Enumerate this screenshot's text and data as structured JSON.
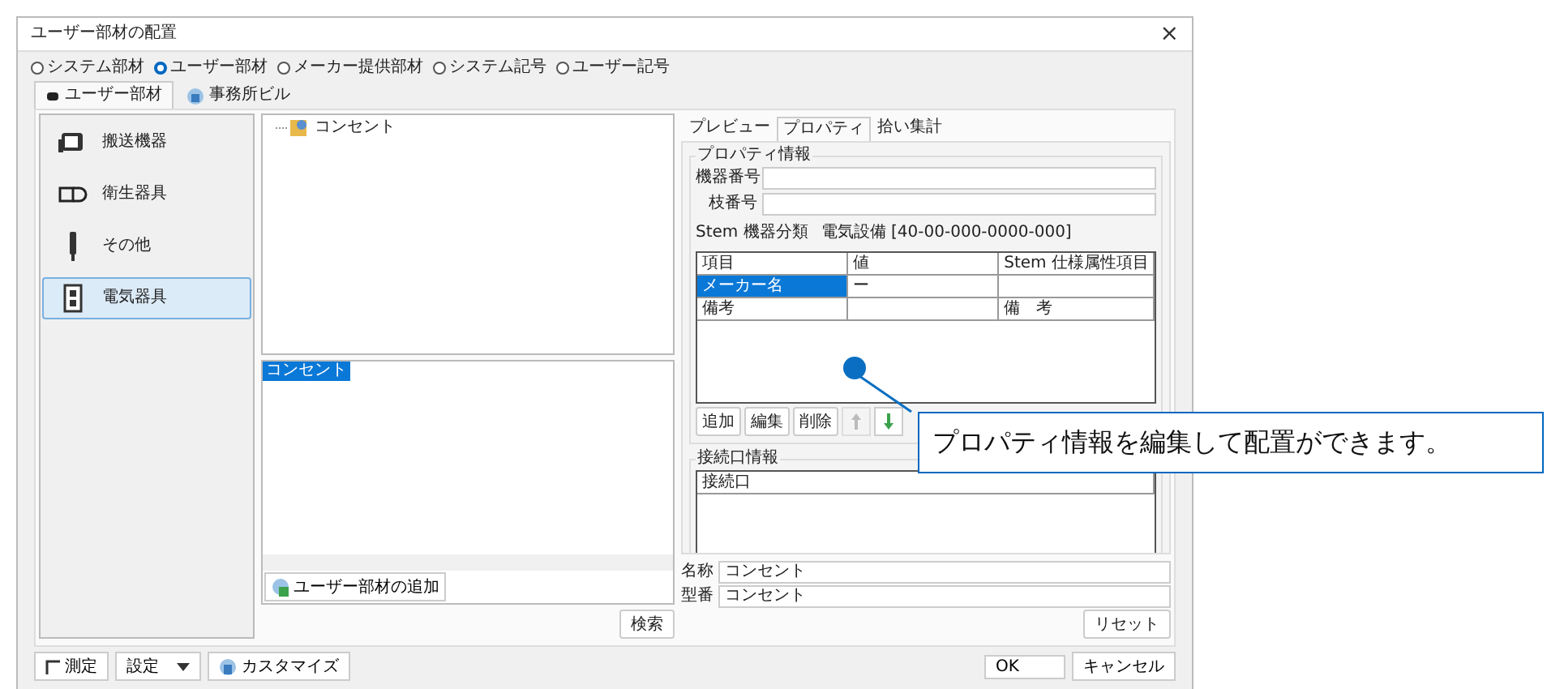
{
  "window": {
    "title": "ユーザー部材の配置",
    "close": "×"
  },
  "source_options": [
    {
      "label": "システム部材",
      "selected": false
    },
    {
      "label": "ユーザー部材",
      "selected": true
    },
    {
      "label": "メーカー提供部材",
      "selected": false
    },
    {
      "label": "システム記号",
      "selected": false
    },
    {
      "label": "ユーザー記号",
      "selected": false
    }
  ],
  "tabs": [
    {
      "label": "ユーザー部材",
      "selected": true
    },
    {
      "label": "事務所ビル",
      "selected": false
    }
  ],
  "categories": [
    {
      "label": "搬送機器",
      "kind": "conveyor",
      "selected": false
    },
    {
      "label": "衛生器具",
      "kind": "sanitary",
      "selected": false
    },
    {
      "label": "その他",
      "kind": "other",
      "selected": false
    },
    {
      "label": "電気器具",
      "kind": "electric",
      "selected": true
    }
  ],
  "tree": [
    {
      "label": "コンセント"
    }
  ],
  "parts_list": [
    {
      "label": "コンセント",
      "selected": true
    }
  ],
  "add_button": "ユーザー部材の追加",
  "search_button": "検索",
  "detail_tabs": [
    {
      "label": "プレビュー",
      "selected": false
    },
    {
      "label": "プロパティ",
      "selected": true
    },
    {
      "label": "拾い集計",
      "selected": false
    }
  ],
  "property_info": {
    "title": "プロパティ情報",
    "fields": [
      {
        "label": "機器番号"
      },
      {
        "label": "枝番号"
      }
    ],
    "stem_label": "Stem 機器分類",
    "stem_value": "電気設備 [40-00-000-0000-000]"
  },
  "table": {
    "columns": [
      "項目",
      "値",
      "Stem 仕様属性項目"
    ],
    "rows": [
      {
        "item": "メーカー名",
        "value": "ー",
        "selected": true
      },
      {
        "item": "備考",
        "stem": "備　考",
        "selected": false
      }
    ]
  },
  "table_buttons": [
    "追加",
    "編集",
    "削除"
  ],
  "move_buttons": [
    {
      "kind": "up",
      "disabled": true
    },
    {
      "kind": "down",
      "disabled": false
    }
  ],
  "connection_info": {
    "title": "接続口情報",
    "columns": [
      "接続口"
    ]
  },
  "name_field": {
    "label": "名称",
    "value": "コンセント"
  },
  "model_field": {
    "label": "型番",
    "value": "コンセント"
  },
  "reset_button": "リセット",
  "footer": {
    "measure_button": "測定",
    "settings_button": "設定",
    "customize_button": "カスタマイズ",
    "ok_button": "OK",
    "cancel_button": "キャンセル"
  },
  "callout": {
    "text": "プロパティ情報を編集して配置ができます。"
  }
}
